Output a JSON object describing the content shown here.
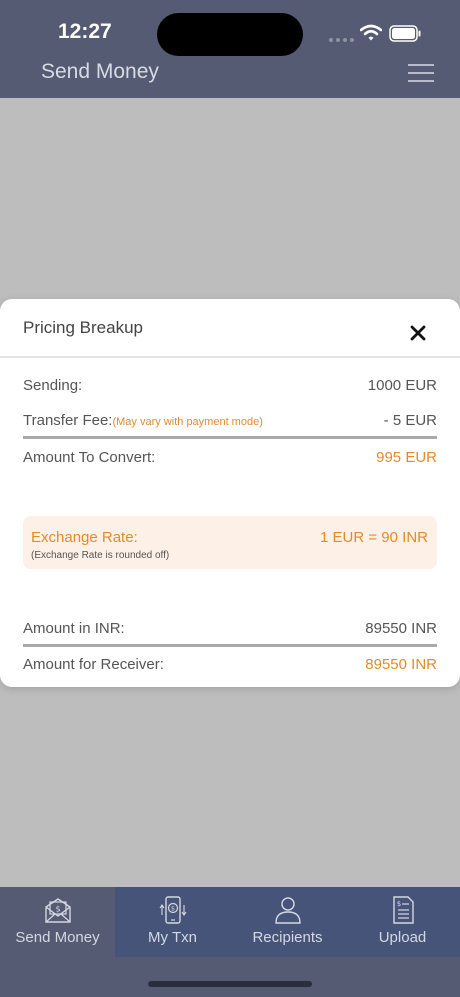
{
  "status_bar": {
    "time": "12:27"
  },
  "header": {
    "title": "Send Money",
    "menu_icon": "hamburger-menu-icon"
  },
  "modal": {
    "title": "Pricing Breakup",
    "close_icon": "close-icon",
    "sending": {
      "label": "Sending:",
      "value": "1000 EUR"
    },
    "transfer_fee": {
      "label": "Transfer Fee:",
      "note": "(May vary with payment mode)",
      "value": "- 5 EUR"
    },
    "amount_to_convert": {
      "label": "Amount To Convert:",
      "value": "995 EUR"
    },
    "exchange_rate": {
      "label": "Exchange Rate:",
      "value": "1 EUR = 90 INR",
      "note": "(Exchange Rate is rounded off)"
    },
    "amount_in_inr": {
      "label": "Amount in INR:",
      "value": "89550 INR"
    },
    "amount_for_receiver": {
      "label": "Amount for Receiver:",
      "value": "89550 INR"
    }
  },
  "tabs": [
    {
      "label": "Send Money",
      "icon": "envelope-money-icon",
      "active": true
    },
    {
      "label": "My Txn",
      "icon": "phone-transaction-icon",
      "active": false
    },
    {
      "label": "Recipients",
      "icon": "person-icon",
      "active": false
    },
    {
      "label": "Upload",
      "icon": "document-icon",
      "active": false
    }
  ],
  "colors": {
    "header_bg": "#545b72",
    "tab_inactive_bg": "#46547a",
    "overlay_bg": "#bdbdbd",
    "accent_orange": "#e58a2a",
    "rate_box_bg": "#fdf0e7"
  }
}
